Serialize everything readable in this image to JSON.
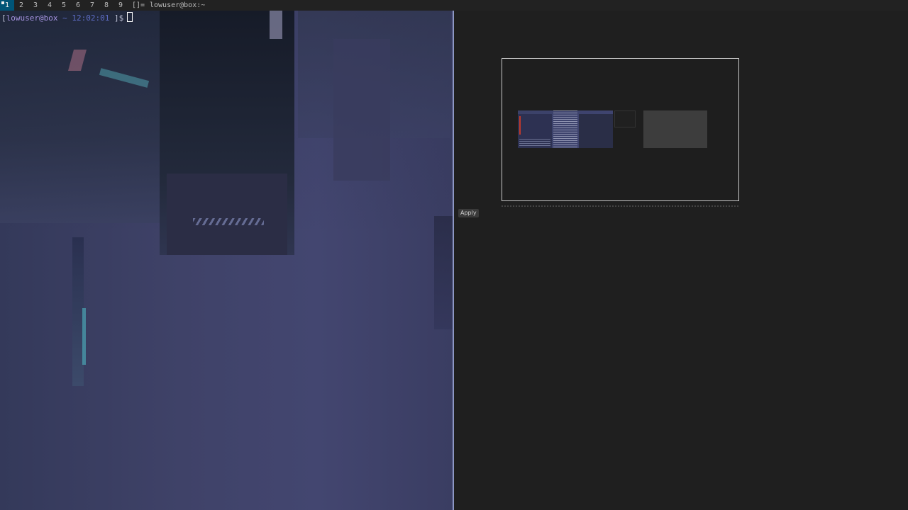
{
  "topbar": {
    "tags": [
      "1",
      "2",
      "3",
      "4",
      "5",
      "6",
      "7",
      "8",
      "9"
    ],
    "active_tag": "1",
    "layout_symbol": "[]=",
    "window_title": "lowuser@box:~"
  },
  "terminal": {
    "prompt_open": "[",
    "user_host": "lowuser@box",
    "cwd": "~",
    "time": "12:02:01",
    "prompt_close": "]$"
  },
  "display_settings": {
    "apply_label": "Apply"
  },
  "colors": {
    "tag_active_bg": "#005577",
    "prompt_user": "#a593e0",
    "prompt_time": "#5d6cc4",
    "terminal_border": "#8d97c4"
  }
}
